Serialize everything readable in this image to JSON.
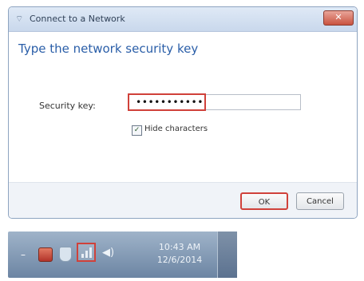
{
  "dialog": {
    "title": "Connect to a Network",
    "close_glyph": "✕",
    "heading": "Type the network security key",
    "security_key_label": "Security key:",
    "security_key_value": "•••••••••••",
    "hide_characters_label": "Hide characters",
    "hide_characters_checked": true,
    "ok_label": "OK",
    "cancel_label": "Cancel"
  },
  "taskbar": {
    "time": "10:43 AM",
    "date": "12/6/2014",
    "icons": [
      "show-hidden-icons-arrow",
      "action-center-flag-icon",
      "security-shield-icon",
      "network-icon",
      "volume-icon"
    ]
  },
  "colors": {
    "highlight": "#d0413a",
    "heading": "#2a5ea8"
  }
}
